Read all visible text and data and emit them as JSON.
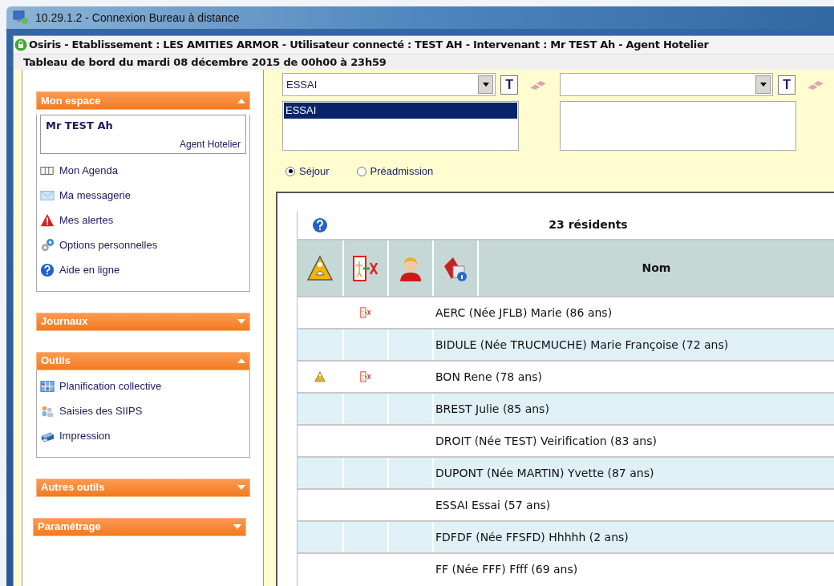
{
  "remote_window": {
    "title": "10.29.1.2 - Connexion Bureau à distance"
  },
  "app": {
    "title": "Osiris - Etablissement : LES AMITIES ARMOR - Utilisateur connecté : TEST AH - Intervenant : Mr TEST Ah - Agent Hotelier",
    "subtitle": "Tableau de bord du mardi 08 décembre 2015 de 00h00 à 23h59"
  },
  "sidebar": {
    "sections": [
      {
        "title": "Mon espace",
        "expanded": true,
        "user": {
          "name": "Mr TEST Ah",
          "role": "Agent Hotelier"
        },
        "items": [
          {
            "label": "Mon Agenda",
            "kind": "agenda"
          },
          {
            "label": "Ma messagerie",
            "kind": "mail"
          },
          {
            "label": "Mes alertes",
            "kind": "alert"
          },
          {
            "label": "Options personnelles",
            "kind": "gears"
          },
          {
            "label": "Aide en ligne",
            "kind": "help"
          }
        ]
      },
      {
        "title": "Journaux",
        "expanded": false
      },
      {
        "title": "Outils",
        "expanded": true,
        "items": [
          {
            "label": "Planification collective",
            "kind": "grid"
          },
          {
            "label": "Saisies des SIIPS",
            "kind": "people"
          },
          {
            "label": "Impression",
            "kind": "printer"
          }
        ]
      },
      {
        "title": "Autres outils",
        "expanded": false
      },
      {
        "title": "Paramétrage",
        "expanded": false
      }
    ]
  },
  "filters": [
    {
      "value": "ESSAI",
      "clear_button": "T",
      "options": [
        {
          "label": "ESSAI",
          "selected": true
        }
      ]
    },
    {
      "clear_button": "T"
    }
  ],
  "stay_types": [
    {
      "label": "Séjour",
      "selected": true
    },
    {
      "label": "Préadmission",
      "selected": false
    }
  ],
  "table": {
    "count": "23 résidents",
    "columns": [
      {
        "kind": "alert"
      },
      {
        "kind": "exit"
      },
      {
        "kind": "person"
      },
      {
        "kind": "file-info"
      },
      {
        "kind": "text",
        "label": "Nom"
      }
    ],
    "rows": [
      {
        "alert": false,
        "exit": true,
        "name": "AERC (Née JFLB) Marie (86 ans)"
      },
      {
        "alert": false,
        "exit": false,
        "name": "BIDULE (Née TRUCMUCHE) Marie Françoise (72 ans)"
      },
      {
        "alert": true,
        "exit": true,
        "name": "BON Rene (78 ans)"
      },
      {
        "alert": false,
        "exit": false,
        "name": "BREST Julie (85 ans)"
      },
      {
        "alert": false,
        "exit": false,
        "name": "DROIT (Née TEST) Veirification (83 ans)"
      },
      {
        "alert": false,
        "exit": false,
        "name": "DUPONT (Née MARTIN) Yvette (87 ans)"
      },
      {
        "alert": false,
        "exit": false,
        "name": "ESSAI Essai (57 ans)"
      },
      {
        "alert": false,
        "exit": false,
        "name": "FDFDF (Née FFSFD) Hhhhh (2 ans)"
      },
      {
        "alert": false,
        "exit": false,
        "name": "FF (Née FFF) Ffff (69 ans)"
      }
    ]
  }
}
